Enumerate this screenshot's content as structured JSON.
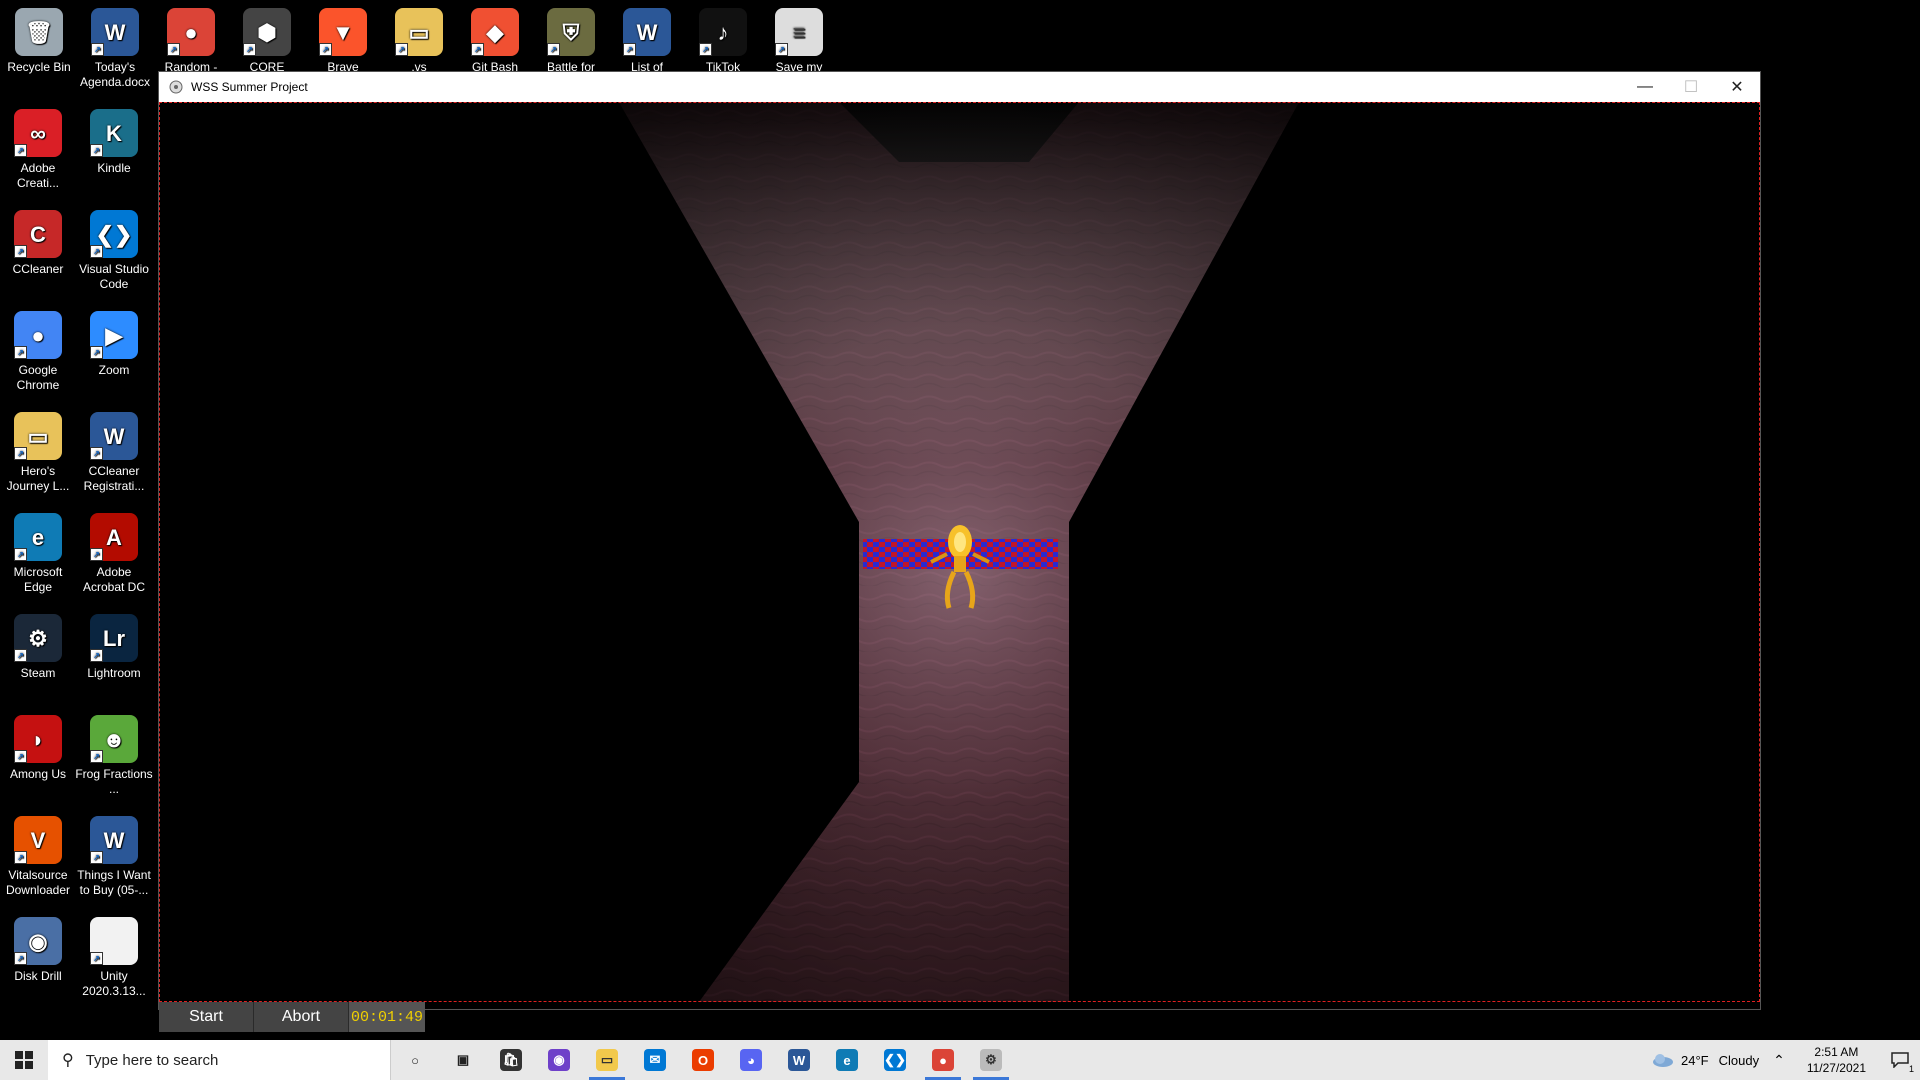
{
  "desktop": {
    "top_row": [
      {
        "label": "Recycle Bin",
        "icon": "recycle-bin-icon"
      },
      {
        "label": "Today's Agenda.docx",
        "icon": "word-document-icon"
      },
      {
        "label": "Random -",
        "icon": "chrome-shortcut-icon"
      },
      {
        "label": "CORE",
        "icon": "core-icon"
      },
      {
        "label": "Brave",
        "icon": "brave-icon"
      },
      {
        "label": ".vs",
        "icon": "folder-icon"
      },
      {
        "label": "Git Bash",
        "icon": "git-bash-icon"
      },
      {
        "label": "Battle for",
        "icon": "battle-shield-icon"
      },
      {
        "label": "List of",
        "icon": "word-document-icon"
      },
      {
        "label": "TikTok",
        "icon": "tiktok-icon"
      },
      {
        "label": "Save my",
        "icon": "text-file-icon"
      }
    ],
    "left_col1": [
      {
        "label": "Adobe Creati...",
        "icon": "adobe-creative-cloud-icon"
      },
      {
        "label": "CCleaner",
        "icon": "ccleaner-icon"
      },
      {
        "label": "Google Chrome",
        "icon": "chrome-icon"
      },
      {
        "label": "Hero's Journey L...",
        "icon": "folder-icon"
      },
      {
        "label": "Microsoft Edge",
        "icon": "edge-icon"
      },
      {
        "label": "Steam",
        "icon": "steam-icon"
      },
      {
        "label": "Among Us",
        "icon": "among-us-icon"
      },
      {
        "label": "Vitalsource Downloader",
        "icon": "vitalsource-icon"
      },
      {
        "label": "Disk Drill",
        "icon": "disk-drill-icon"
      }
    ],
    "left_col2": [
      {
        "label": "Kindle",
        "icon": "kindle-icon"
      },
      {
        "label": "Visual Studio Code",
        "icon": "vscode-icon"
      },
      {
        "label": "Zoom",
        "icon": "zoom-icon"
      },
      {
        "label": "CCleaner Registrati...",
        "icon": "word-document-icon"
      },
      {
        "label": "Adobe Acrobat DC",
        "icon": "acrobat-icon"
      },
      {
        "label": "Lightroom",
        "icon": "lightroom-icon"
      },
      {
        "label": "Frog Fractions ...",
        "icon": "frog-icon"
      },
      {
        "label": "Things I Want to Buy (05-...",
        "icon": "word-document-icon"
      },
      {
        "label": "Unity 2020.3.13...",
        "icon": "blank-file-icon"
      }
    ]
  },
  "window": {
    "title": "WSS Summer Project",
    "minimize": "—",
    "maximize": "☐",
    "close": "✕"
  },
  "controls": {
    "start": "Start",
    "abort": "Abort",
    "timer": "00:01:49"
  },
  "taskbar": {
    "search_placeholder": "Type here to search",
    "apps": [
      "cortana-icon",
      "task-view-icon",
      "store-icon",
      "github-desktop-icon",
      "file-explorer-icon",
      "mail-icon",
      "office-icon",
      "discord-icon",
      "word-icon",
      "edge-icon",
      "vscode-icon",
      "chrome-icon",
      "unity-game-icon"
    ],
    "weather_temp": "24°F",
    "weather_desc": "Cloudy",
    "time": "2:51 AM",
    "date": "11/27/2021",
    "notifications": "1"
  },
  "colors": {
    "accent_border": "#e02020",
    "timer_text": "#f0d000",
    "floor": "#3d1f26"
  }
}
